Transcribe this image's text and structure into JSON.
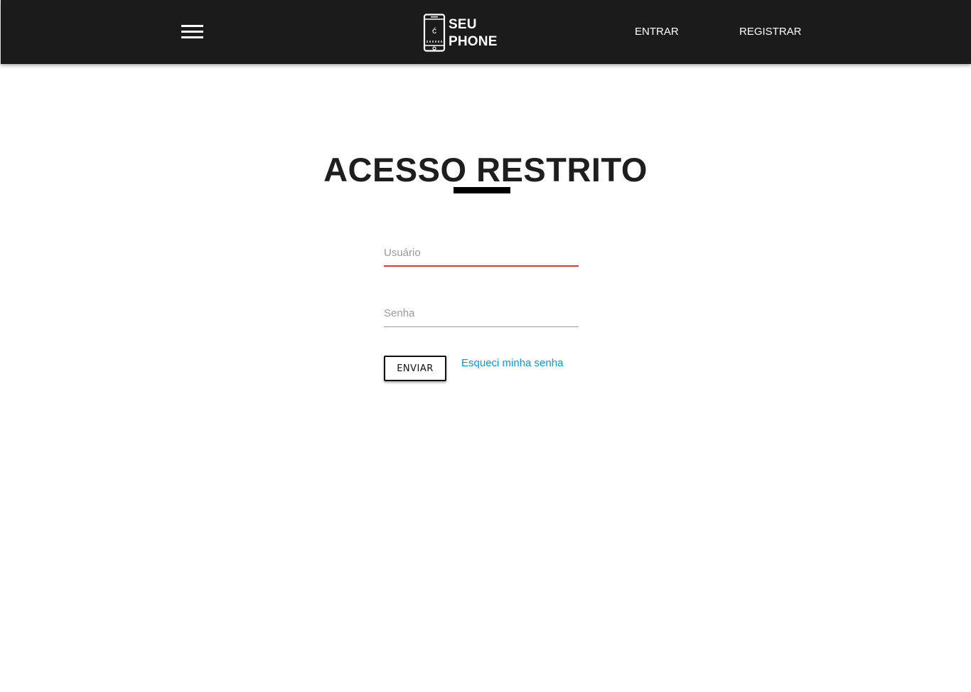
{
  "header": {
    "menu_icon": "hamburger-menu-icon",
    "logo": {
      "icon": "smartphone-icon",
      "line1": "SEU",
      "line2": "PHONE"
    },
    "nav": {
      "login": "ENTRAR",
      "register": "REGISTRAR"
    }
  },
  "main": {
    "title": "ACESSO RESTRITO",
    "form": {
      "username_placeholder": "Usuário",
      "username_value": "",
      "password_placeholder": "Senha",
      "password_value": "",
      "submit_label": "ENVIAR",
      "forgot_password": "Esqueci minha senha"
    }
  },
  "colors": {
    "navbar_bg": "#1b1b1b",
    "active_underline": "#e53935",
    "link": "#039be5",
    "title": "#1e1e1e"
  }
}
